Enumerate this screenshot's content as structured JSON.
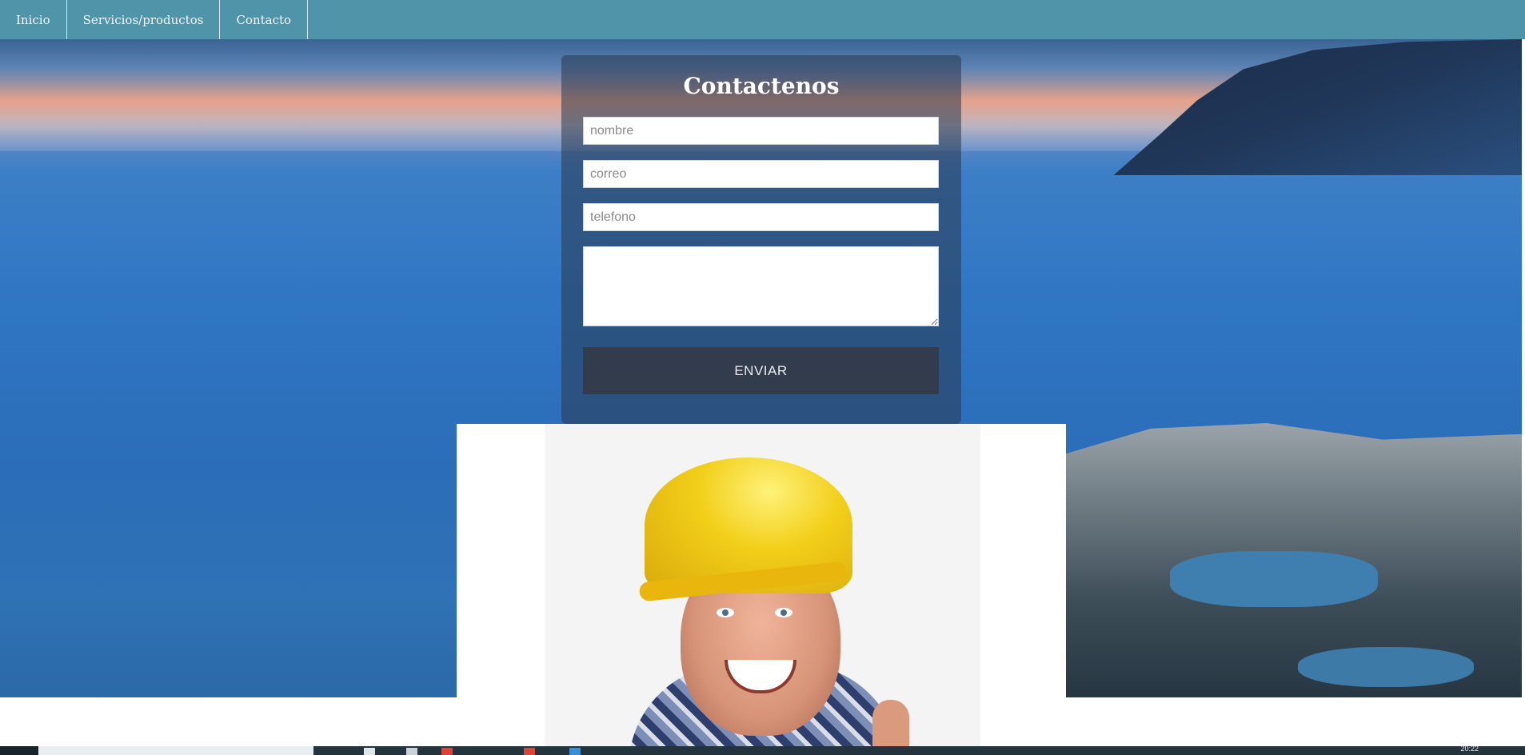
{
  "nav": {
    "items": [
      {
        "label": "Inicio"
      },
      {
        "label": "Servicios/productos"
      },
      {
        "label": "Contacto"
      }
    ]
  },
  "contact_form": {
    "title": "Contactenos",
    "name_placeholder": "nombre",
    "email_placeholder": "correo",
    "phone_placeholder": "telefono",
    "message_value": "",
    "submit_label": "ENVIAR"
  },
  "taskbar": {
    "clock": "20:22"
  },
  "colors": {
    "nav_bg": "#4f94a8",
    "card_overlay": "rgba(42,56,78,0.55)",
    "button_bg": "#333c4d"
  }
}
